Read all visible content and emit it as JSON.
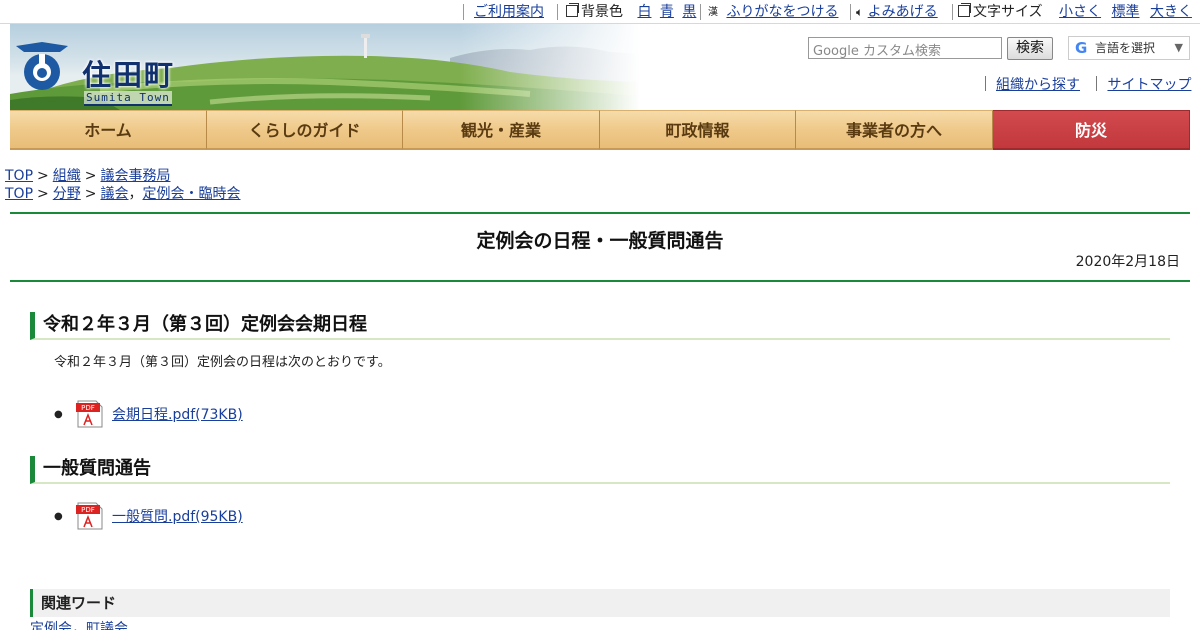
{
  "utility": {
    "guide": "ご利用案内",
    "bg_label": "背景色",
    "bg_white": "白",
    "bg_blue": "青",
    "bg_black": "黒",
    "furigana": "ふりがなをつける",
    "read_aloud": "よみあげる",
    "font_label": "文字サイズ",
    "font_small": "小さく",
    "font_normal": "標準",
    "font_large": "大きく"
  },
  "header": {
    "town_name": "住田町",
    "town_name_en": "Sumita Town",
    "search_placeholder": "Google カスタム検索",
    "search_button": "検索",
    "language_label": "言語を選択",
    "org_link": "組織から探す",
    "sitemap_link": "サイトマップ"
  },
  "nav": {
    "items": [
      "ホーム",
      "くらしのガイド",
      "観光・産業",
      "町政情報",
      "事業者の方へ",
      "防災"
    ]
  },
  "breadcrumbs": {
    "row1": [
      "TOP",
      "組織",
      "議会事務局"
    ],
    "row2": [
      "TOP",
      "分野",
      "議会",
      "定例会・臨時会"
    ]
  },
  "page": {
    "title": "定例会の日程・一般質問通告",
    "date": "2020年2月18日"
  },
  "sections": [
    {
      "heading": "令和２年３月（第３回）定例会会期日程",
      "text": "令和２年３月（第３回）定例会の日程は次のとおりです。",
      "file": "会期日程.pdf(73KB)"
    },
    {
      "heading": "一般質問通告",
      "file": "一般質問.pdf(95KB)"
    }
  ],
  "related": {
    "heading": "関連ワード",
    "links": [
      "定例会",
      "町議会"
    ]
  },
  "colors": {
    "accent_green": "#1a8a3a",
    "nav_wood": "#efc98a",
    "disaster_red": "#c2383c",
    "link_blue": "#1a3f9b"
  }
}
